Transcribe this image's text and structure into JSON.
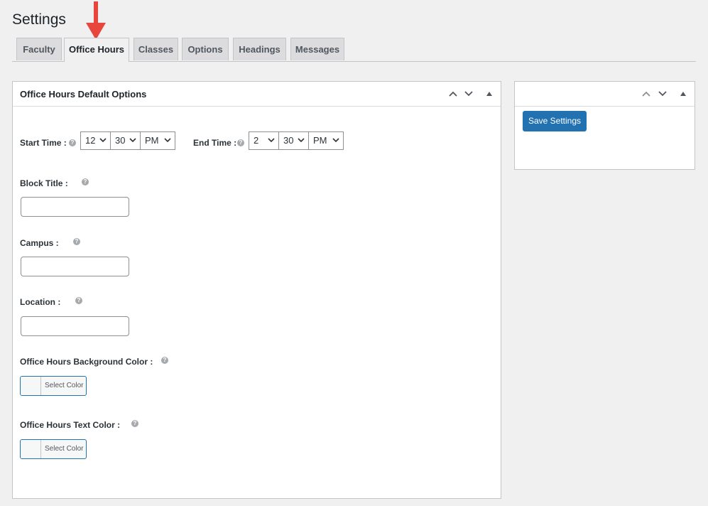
{
  "page": {
    "title": "Settings"
  },
  "tabs": [
    {
      "label": "Faculty"
    },
    {
      "label": "Office Hours"
    },
    {
      "label": "Classes"
    },
    {
      "label": "Options"
    },
    {
      "label": "Headings"
    },
    {
      "label": "Messages"
    }
  ],
  "active_tab": "Office Hours",
  "main_box": {
    "title": "Office Hours Default Options",
    "start_time": {
      "label": "Start Time :",
      "hour": "12",
      "minute": "30",
      "period": "PM"
    },
    "end_time": {
      "label": "End Time :",
      "hour": "2",
      "minute": "30",
      "period": "PM"
    },
    "block_title": {
      "label": "Block Title :",
      "value": ""
    },
    "campus": {
      "label": "Campus :",
      "value": ""
    },
    "location": {
      "label": "Location :",
      "value": ""
    },
    "bg_color": {
      "label": "Office Hours Background Color :",
      "button": "Select Color"
    },
    "text_color": {
      "label": "Office Hours Text Color :",
      "button": "Select Color"
    },
    "help_glyph": "?"
  },
  "side_box": {
    "save_label": "Save Settings"
  },
  "colors": {
    "primary": "#2271b1",
    "annotation_arrow": "#e8453c",
    "background": "#f0f0f1"
  }
}
